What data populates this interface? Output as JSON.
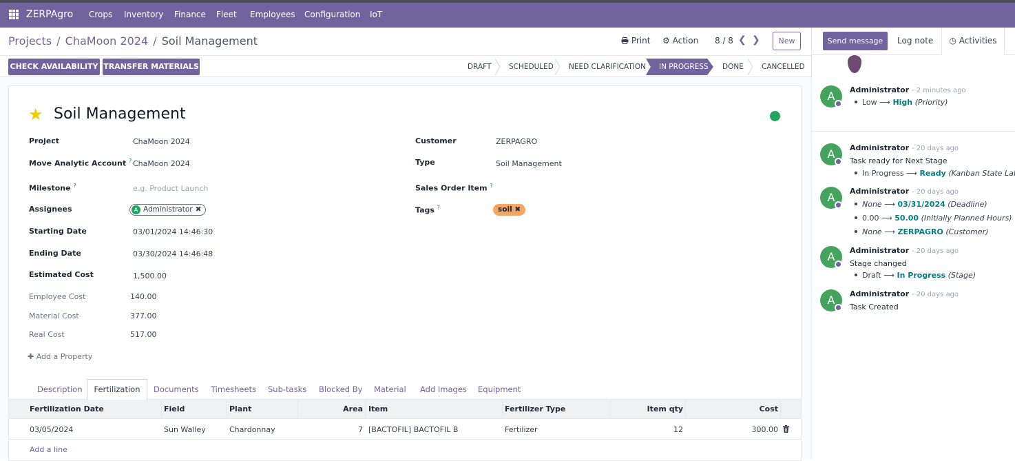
{
  "topbar": {
    "brand": "ZERPAgro",
    "menu": [
      "Crops",
      "Inventory",
      "Finance",
      "Fleet",
      "Employees",
      "Configuration",
      "IoT"
    ]
  },
  "breadcrumb": {
    "items": [
      "Projects",
      "ChaMoon 2024"
    ],
    "current": "Soil Management",
    "separator": "/"
  },
  "toolbar": {
    "print": "Print",
    "action": "Action",
    "pager": "8 / 8",
    "new": "New"
  },
  "actions": {
    "check_availability": "CHECK AVAILABILITY",
    "transfer_materials": "TRANSFER MATERIALS"
  },
  "stages": [
    "DRAFT",
    "SCHEDULED",
    "NEED CLARIFICATION",
    "IN PROGRESS",
    "DONE",
    "CANCELLED"
  ],
  "active_stage": "IN PROGRESS",
  "record": {
    "title": "Soil Management",
    "starred": true,
    "kanban_state_color": "#21a65b"
  },
  "fields": {
    "project": {
      "label": "Project",
      "value": "ChaMoon 2024"
    },
    "analytic": {
      "label": "Move Analytic Account",
      "help": "?",
      "value": "ChaMoon 2024"
    },
    "milestone": {
      "label": "Milestone",
      "help": "?",
      "placeholder": "e.g. Product Launch"
    },
    "assignees": {
      "label": "Assignees",
      "avatar": "A",
      "value": "Administrator"
    },
    "starting_date": {
      "label": "Starting Date",
      "value": "03/01/2024 14:46:30"
    },
    "ending_date": {
      "label": "Ending Date",
      "value": "03/30/2024 14:46:48"
    },
    "estimated_cost": {
      "label": "Estimated Cost",
      "value": "1,500.00"
    },
    "employee_cost": {
      "label": "Employee Cost",
      "value": "140.00"
    },
    "material_cost": {
      "label": "Material Cost",
      "value": "377.00"
    },
    "real_cost": {
      "label": "Real Cost",
      "value": "517.00"
    },
    "customer": {
      "label": "Customer",
      "value": "ZERPAGRO"
    },
    "type": {
      "label": "Type",
      "value": "Soil Management"
    },
    "sales_order_item": {
      "label": "Sales Order Item",
      "help": "?"
    },
    "tags": {
      "label": "Tags",
      "help": "?",
      "items": [
        "soil"
      ]
    },
    "add_property": "Add a Property"
  },
  "tabs": [
    "Description",
    "Fertilization",
    "Documents",
    "Timesheets",
    "Sub-tasks",
    "Blocked By",
    "Material",
    "Add Images",
    "Equipment"
  ],
  "active_tab": "Fertilization",
  "table": {
    "columns": [
      "Fertilization Date",
      "Field",
      "Plant",
      "Area",
      "Item",
      "Fertilizer Type",
      "Item qty",
      "Cost"
    ],
    "rows": [
      [
        "03/05/2024",
        "Sun Walley",
        "Chardonnay",
        "7",
        "[BACTOFIL] BACTOFIL B",
        "Fertilizer",
        "12",
        "300.00"
      ]
    ],
    "add_line": "Add a line"
  },
  "chatter": {
    "send_message": "Send message",
    "log_note": "Log note",
    "activities": "Activities",
    "messages": [
      {
        "author": "Administrator",
        "time": "- 2 minutes ago",
        "changes": [
          {
            "old": "Low",
            "new": "High",
            "field": "(Priority)"
          }
        ]
      },
      {
        "author": "Administrator",
        "time": "- 20 days ago",
        "body": "Task ready for Next Stage",
        "changes": [
          {
            "old": "In Progress",
            "new": "Ready",
            "field": "(Kanban State Label)"
          }
        ]
      },
      {
        "author": "Administrator",
        "time": "- 20 days ago",
        "changes": [
          {
            "old": "None",
            "new": "03/31/2024",
            "field": "(Deadline)"
          },
          {
            "old": "0.00",
            "new": "50.00",
            "field": "(Initially Planned Hours)"
          },
          {
            "old": "None",
            "new": "ZERPAGRO",
            "field": "(Customer)"
          }
        ]
      },
      {
        "author": "Administrator",
        "time": "- 20 days ago",
        "body": "Stage changed",
        "changes": [
          {
            "old": "Draft",
            "new": "In Progress",
            "field": "(Stage)"
          }
        ]
      },
      {
        "author": "Administrator",
        "time": "- 20 days ago",
        "body": "Task Created"
      }
    ],
    "avatar_letter": "A"
  },
  "colors": {
    "brand": "#71639e",
    "link": "#017e84",
    "star": "#f3cc00",
    "tag": "#f5a665",
    "avatar": "#44a35c"
  }
}
